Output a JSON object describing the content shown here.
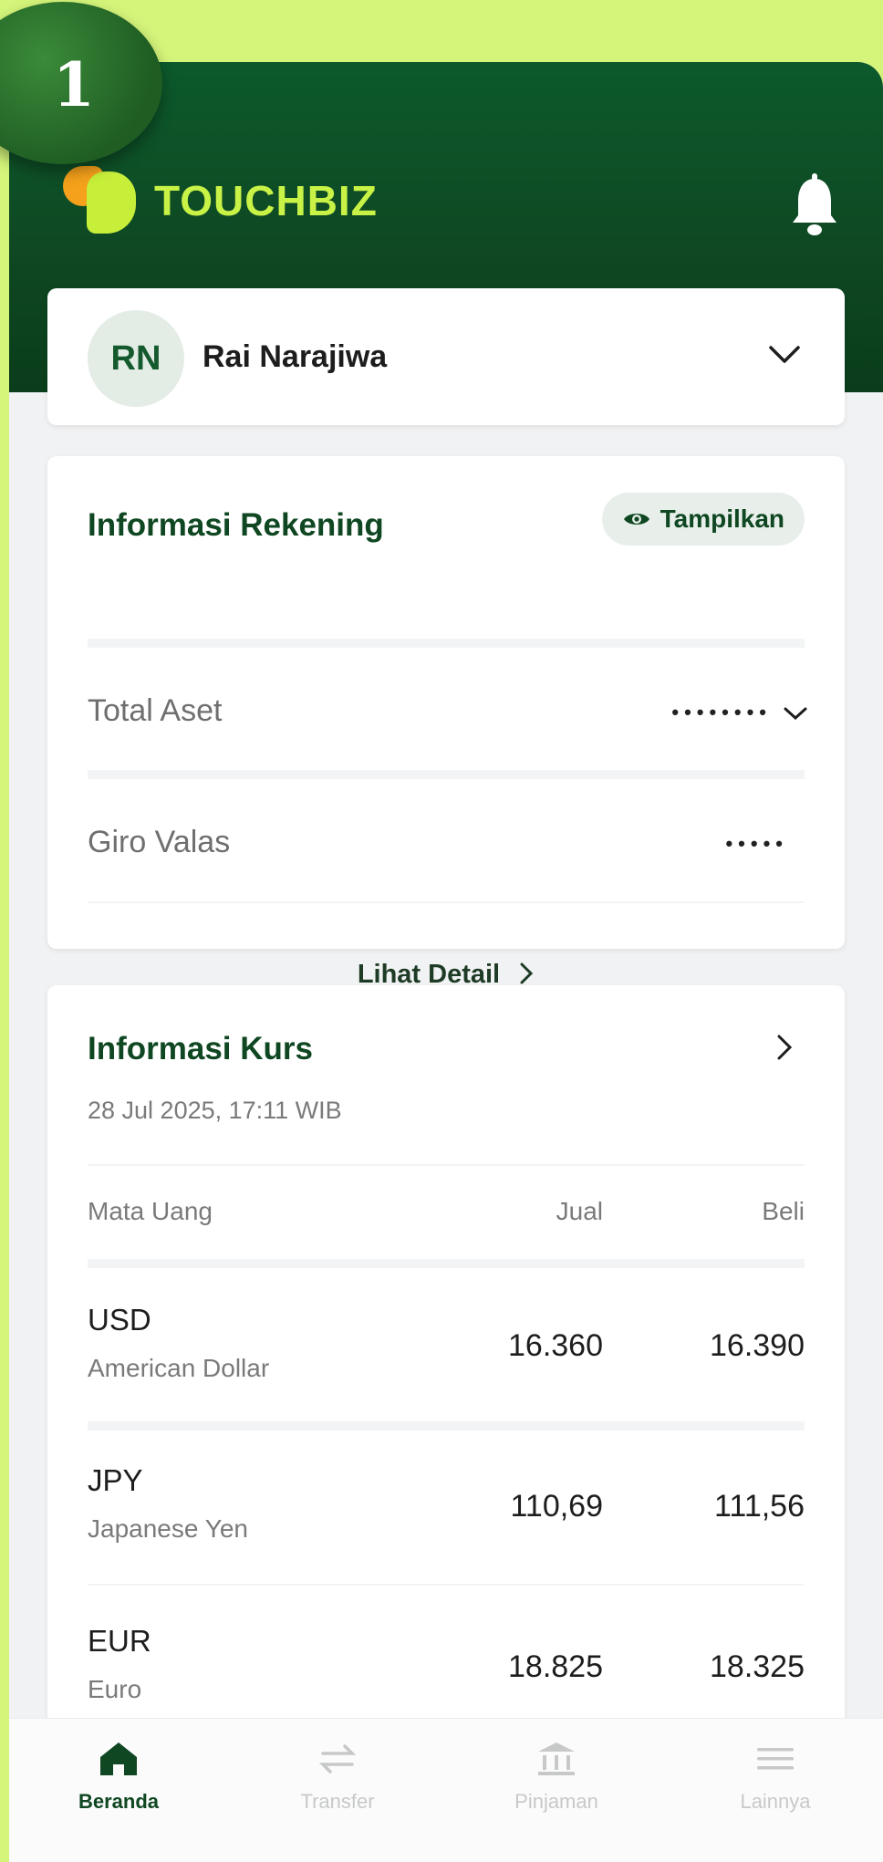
{
  "step_badge": "1",
  "brand": {
    "name": "TOUCHBIZ"
  },
  "account": {
    "initials": "RN",
    "name": "Rai Narajiwa"
  },
  "account_info": {
    "title": "Informasi Rekening",
    "show_label": "Tampilkan",
    "rows": [
      {
        "label": "Total Aset",
        "value": "••••••••"
      },
      {
        "label": "Giro Valas",
        "value": "•••••"
      }
    ],
    "detail_link": "Lihat Detail"
  },
  "exchange": {
    "title": "Informasi Kurs",
    "timestamp": "28 Jul 2025, 17:11 WIB",
    "columns": [
      "Mata Uang",
      "Jual",
      "Beli"
    ],
    "rows": [
      {
        "code": "USD",
        "name": "American Dollar",
        "sell": "16.360",
        "buy": "16.390"
      },
      {
        "code": "JPY",
        "name": "Japanese Yen",
        "sell": "110,69",
        "buy": "111,56"
      },
      {
        "code": "EUR",
        "name": "Euro",
        "sell": "18.825",
        "buy": "18.325"
      }
    ]
  },
  "nav": {
    "items": [
      {
        "label": "Beranda",
        "icon": "home-icon",
        "active": true
      },
      {
        "label": "Transfer",
        "icon": "transfer-icon",
        "active": false
      },
      {
        "label": "Pinjaman",
        "icon": "bank-icon",
        "active": false
      },
      {
        "label": "Lainnya",
        "icon": "menu-icon",
        "active": false
      }
    ]
  },
  "colors": {
    "brand_green": "#0f4722",
    "accent_lime": "#c9f246",
    "background": "#d4f47a"
  }
}
